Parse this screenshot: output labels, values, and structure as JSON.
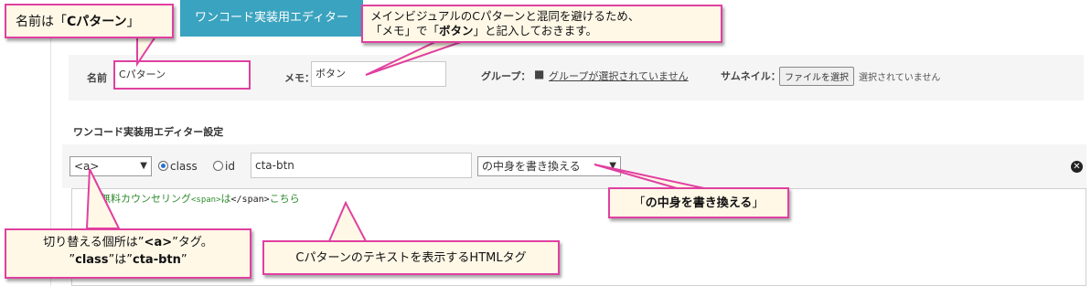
{
  "tab": {
    "label": "ワンコード実装用エディター"
  },
  "fields": {
    "name_label": "名前",
    "name_value": "Cパターン",
    "memo_label": "メモ：",
    "memo_value": "ボタン",
    "group_label": "グループ：",
    "group_link": "グループが選択されていません",
    "thumbnail_label": "サムネイル：",
    "file_button": "ファイルを選択",
    "file_status": "選択されていません"
  },
  "section_title": "ワンコード実装用エディター設定",
  "editor": {
    "tag_select": "<a>",
    "radio_class": "class",
    "radio_id": "id",
    "selector_value": "cta-btn",
    "action_select": "の中身を書き換える",
    "code_text": "無料カウンセリング",
    "code_tag_open": "<span>",
    "code_mid": "は",
    "code_tag_close": "</span>",
    "code_tail": "こちら"
  },
  "callouts": {
    "name_a": "名前は「",
    "name_b": "Cパターン",
    "name_c": "」",
    "memo_line1": "メインビジュアルのCパターンと混同を避けるため、",
    "memo_line2_a": "「メモ」で「",
    "memo_line2_b": "ボタン",
    "memo_line2_c": "」と記入しておきます。",
    "action_a": "「",
    "action_b": "の中身を書き換える",
    "action_c": "」",
    "switch_line1_a": "切り替える個所は”",
    "switch_line1_b": "<a>",
    "switch_line1_c": "”タグ。",
    "switch_line2_a": "”",
    "switch_line2_b": "class",
    "switch_line2_c": "”は”",
    "switch_line2_d": "cta-btn",
    "switch_line2_e": "”",
    "html_tag": "Cパターンのテキストを表示するHTMLタグ"
  },
  "colors": {
    "accent_tab": "#3aa3bf",
    "callout_border": "#e040a0",
    "callout_bg": "#fff8e7"
  }
}
